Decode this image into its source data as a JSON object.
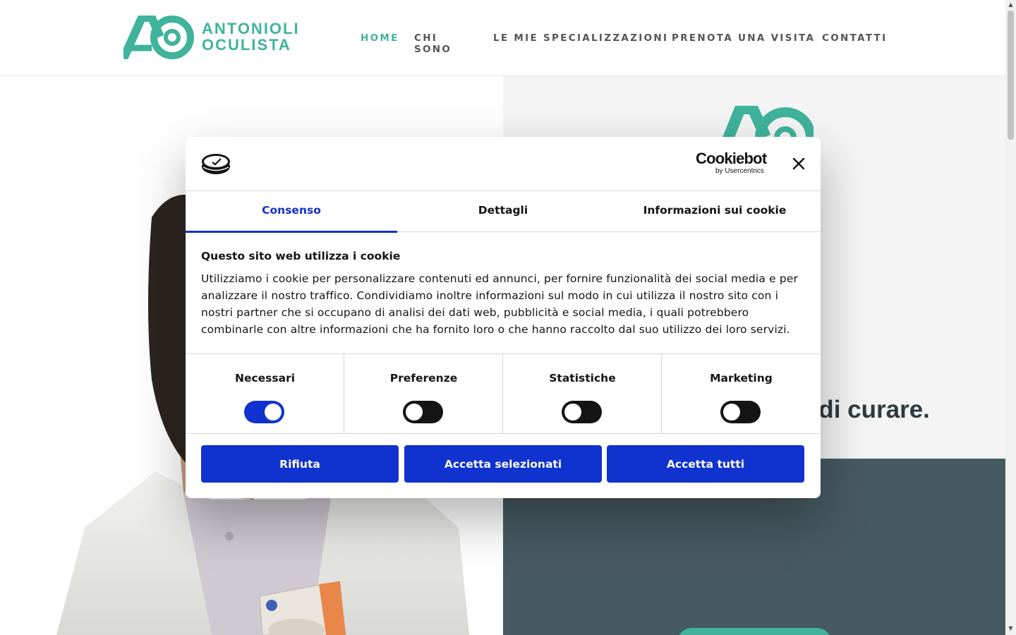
{
  "site": {
    "logo_line1": "ANTONIOLI",
    "logo_line2": "OCULISTA",
    "brand_color": "#3fb39c",
    "nav": [
      {
        "label": "HOME",
        "active": true
      },
      {
        "label": "CHI SONO"
      },
      {
        "label": "LE MIE SPECIALIZZAZIONI"
      },
      {
        "label": "PRENOTA UNA VISITA"
      },
      {
        "label": "CONTATTI"
      }
    ],
    "hero_tagline_visible": "ma di curare."
  },
  "cookie_dialog": {
    "logo_icon": "cookie-icon",
    "brand_name": "Cookiebot",
    "brand_by": "by Usercentrics",
    "close_icon": "close-icon",
    "tabs": [
      {
        "label": "Consenso",
        "active": true
      },
      {
        "label": "Dettagli"
      },
      {
        "label": "Informazioni sui cookie"
      }
    ],
    "title": "Questo sito web utilizza i cookie",
    "text": "Utilizziamo i cookie per personalizzare contenuti ed annunci, per fornire funzionalità dei social media e per analizzare il nostro traffico. Condividiamo inoltre informazioni sul modo in cui utilizza il nostro sito con i nostri partner che si occupano di analisi dei dati web, pubblicità e social media, i quali potrebbero combinarle con altre informazioni che ha fornito loro o che hanno raccolto dal suo utilizzo dei loro servizi.",
    "toggles": [
      {
        "label": "Necessari",
        "checked": true
      },
      {
        "label": "Preferenze",
        "checked": false
      },
      {
        "label": "Statistiche",
        "checked": false
      },
      {
        "label": "Marketing",
        "checked": false
      }
    ],
    "buttons": {
      "reject": "Rifiuta",
      "accept_selected": "Accetta selezionati",
      "accept_all": "Accetta tutti"
    },
    "accent_color": "#1032cf"
  }
}
